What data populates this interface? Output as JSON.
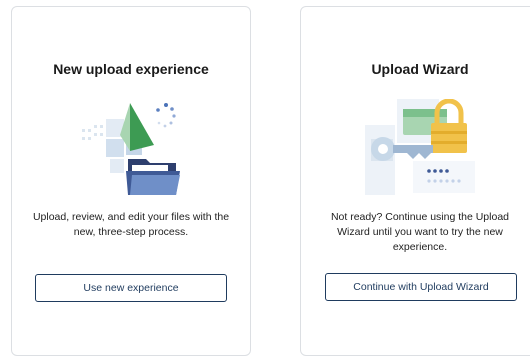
{
  "cards": [
    {
      "title": "New upload experience",
      "description": "Upload, review, and edit your files with the new, three-step process.",
      "button_label": "Use new experience",
      "illustration": "folder-upload-illustration"
    },
    {
      "title": "Upload Wizard",
      "description": "Not ready? Continue using the Upload Wizard until you want to try the new experience.",
      "button_label": "Continue with Upload Wizard",
      "illustration": "key-lock-illustration"
    }
  ],
  "colors": {
    "border": "#dcdfe3",
    "button_border": "#1f3b5e",
    "green": "#3d9b53",
    "navy": "#2e3f6e",
    "gold": "#f1c24a",
    "light_blue": "#c7d8e8"
  }
}
